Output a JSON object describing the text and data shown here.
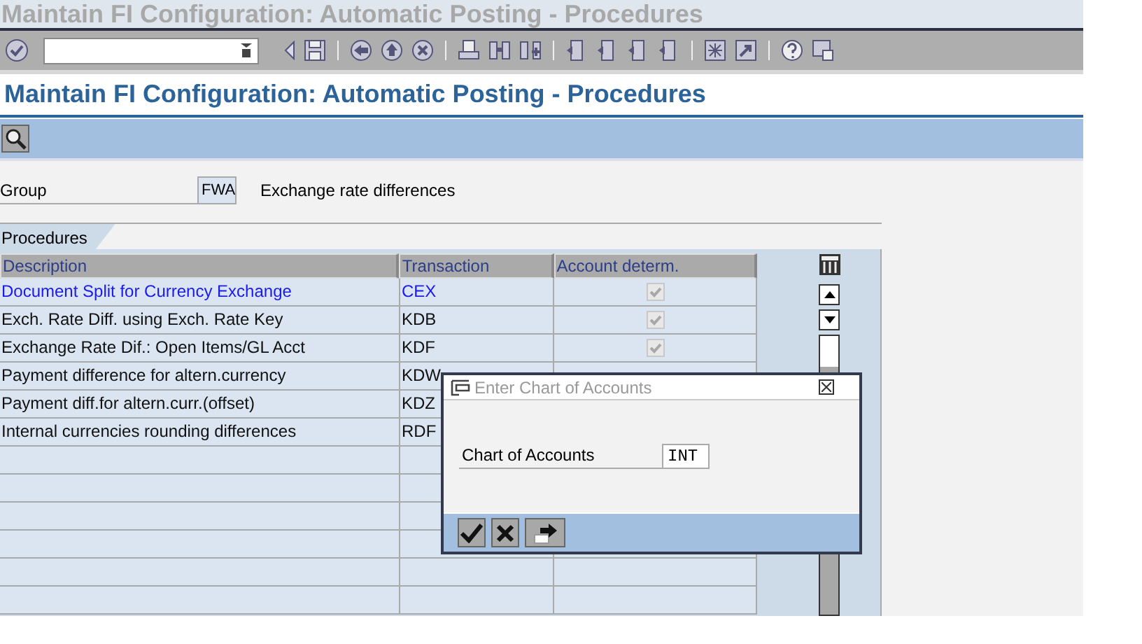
{
  "window": {
    "title": "Maintain FI Configuration: Automatic Posting - Procedures"
  },
  "screen_title": "Maintain FI Configuration: Automatic Posting - Procedures",
  "group": {
    "label": "Group",
    "value": "FWA",
    "description": "Exchange rate differences"
  },
  "table": {
    "tab": "Procedures",
    "columns": [
      "Description",
      "Transaction",
      "Account determ."
    ],
    "rows": [
      {
        "description": "Document Split for Currency Exchange",
        "transaction": "CEX",
        "hotspot": true,
        "checked": true
      },
      {
        "description": "Exch. Rate Diff. using Exch. Rate Key",
        "transaction": "KDB",
        "hotspot": false,
        "checked": true
      },
      {
        "description": "Exchange Rate Dif.: Open Items/GL Acct",
        "transaction": "KDF",
        "hotspot": false,
        "checked": true
      },
      {
        "description": "Payment difference for altern.currency",
        "transaction": "KDW",
        "hotspot": false
      },
      {
        "description": "Payment diff.for altern.curr.(offset)",
        "transaction": "KDZ",
        "hotspot": false
      },
      {
        "description": "Internal currencies rounding differences",
        "transaction": "RDF",
        "hotspot": false
      }
    ]
  },
  "dialog": {
    "title": "Enter Chart of Accounts",
    "field": {
      "label": "Chart of Accounts",
      "value": "INT"
    }
  }
}
